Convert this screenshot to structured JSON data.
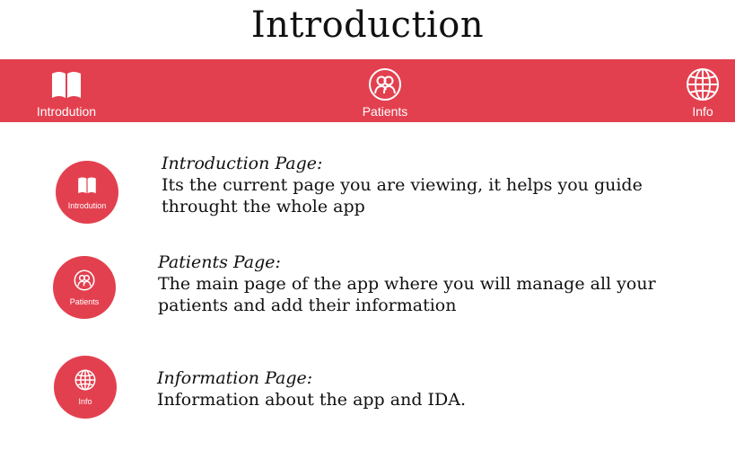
{
  "page": {
    "title": "Introduction"
  },
  "navbar": {
    "items": [
      {
        "label": "Introdution",
        "icon": "book-icon"
      },
      {
        "label": "Patients",
        "icon": "patients-icon"
      },
      {
        "label": "Info",
        "icon": "globe-icon"
      }
    ]
  },
  "entries": [
    {
      "circle_label": "Introdution",
      "icon": "book-icon",
      "title": "Introduction Page:",
      "description": "Its the current page you are viewing, it helps you guide throught the whole app"
    },
    {
      "circle_label": "Patients",
      "icon": "patients-icon",
      "title": "Patients Page:",
      "description": "The main page of the app where you will manage all your patients and add their information"
    },
    {
      "circle_label": "Info",
      "icon": "globe-icon",
      "title": "Information Page:",
      "description": "Information about the app and IDA."
    }
  ],
  "colors": {
    "accent": "#e3404f",
    "text": "#111111",
    "background": "#ffffff"
  }
}
